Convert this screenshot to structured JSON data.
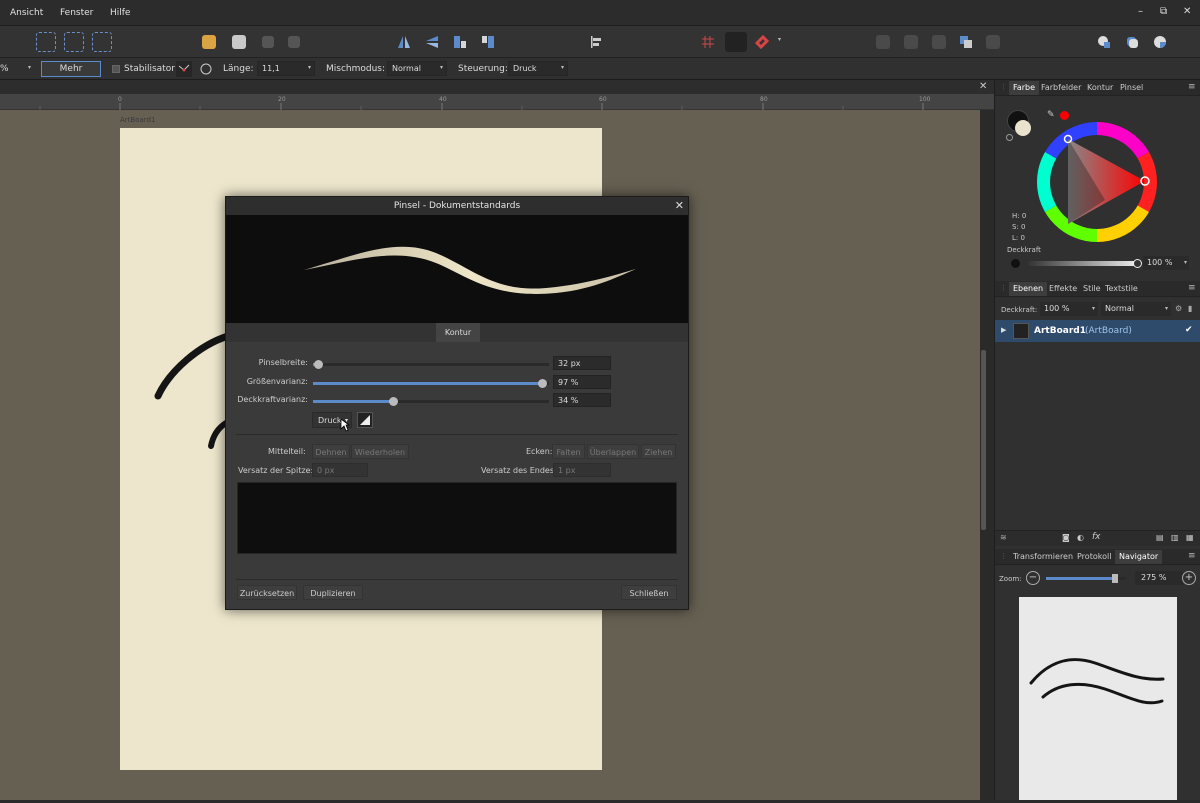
{
  "menubar": {
    "items": [
      "Ansicht",
      "Fenster",
      "Hilfe"
    ],
    "window_controls": [
      "–",
      "⧉",
      "✕"
    ]
  },
  "context_toolbar": {
    "percent_fragment": "%",
    "more_button": "Mehr",
    "stabilizer_label": "Stabilisator",
    "length_label": "Länge:",
    "length_value": "11,1",
    "blend_mode_label": "Mischmodus:",
    "blend_mode_value": "Normal",
    "control_label": "Steuerung:",
    "control_value": "Druck"
  },
  "document": {
    "close_symbol": "✕",
    "ruler_ticks": [
      "0",
      "20",
      "40",
      "60",
      "80",
      "100"
    ],
    "artboard_label": "ArtBoard1"
  },
  "dialog": {
    "title": "Pinsel - Dokumentstandards",
    "close_symbol": "✕",
    "tab_label": "Kontur",
    "brush_width_label": "Pinselbreite:",
    "brush_width_value": "32 px",
    "brush_width_fraction": 0.02,
    "size_variance_label": "Größenvarianz:",
    "size_variance_value": "97 %",
    "size_variance_fraction": 0.97,
    "opacity_variance_label": "Deckkraftvarianz:",
    "opacity_variance_value": "34 %",
    "opacity_variance_fraction": 0.34,
    "controller_value": "Druck",
    "middle_part_label": "Mittelteil:",
    "stretch_button": "Dehnen",
    "repeat_button": "Wiederholen",
    "corners_label": "Ecken:",
    "fold_button": "Falten",
    "overlap_button": "Überlappen",
    "pull_button": "Ziehen",
    "tip_offset_label": "Versatz der Spitze:",
    "tip_offset_value": "0 px",
    "end_offset_label": "Versatz des Endes:",
    "end_offset_value": "1 px",
    "reset_button": "Zurücksetzen",
    "duplicate_button": "Duplizieren",
    "close_button": "Schließen"
  },
  "color_panel": {
    "tabs": [
      "Farbe",
      "Farbfelder",
      "Kontur",
      "Pinsel"
    ],
    "hsl": [
      "H: 0",
      "S: 0",
      "L: 0"
    ],
    "opacity_label": "Deckkraft",
    "opacity_value": "100 %",
    "opacity_fraction": 1.0
  },
  "layers_panel": {
    "tabs": [
      "Ebenen",
      "Effekte",
      "Stile",
      "Textstile"
    ],
    "opacity_label": "Deckkraft:",
    "opacity_value": "100 %",
    "blend_value": "Normal",
    "layer_name": "ArtBoard1",
    "layer_type": "(ArtBoard)",
    "checkmark": "✔",
    "fx_label": "fx"
  },
  "navigator_panel": {
    "tabs": [
      "Transformieren",
      "Protokoll",
      "Navigator"
    ],
    "zoom_label": "Zoom:",
    "zoom_value": "275 %",
    "zoom_fraction": 0.88
  },
  "colors": {
    "accent": "#5b8bcb",
    "canvas": "#666052",
    "artboard": "#ede6cc",
    "active_color": "#ff0000"
  },
  "icons": [
    "select-icon",
    "stabilizer-rope-icon",
    "stabilizer-window-icon",
    "flip-icon",
    "snapping-icon",
    "color-wheel-icon",
    "navigator-icon"
  ]
}
